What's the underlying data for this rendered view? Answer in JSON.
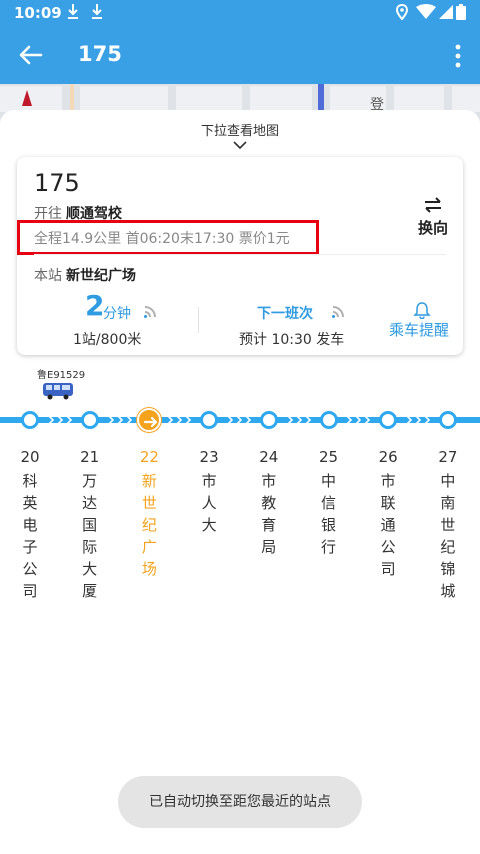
{
  "status_bar": {
    "time": "10:09",
    "icons": [
      "download-icon",
      "download-icon",
      "location-icon",
      "wifi-icon",
      "signal-icon",
      "battery-icon"
    ]
  },
  "app_bar": {
    "title": "175",
    "back_icon": "arrow-left-icon",
    "more_icon": "more-vert-icon"
  },
  "map": {
    "label": "登"
  },
  "sheet": {
    "pull_hint": "下拉查看地图"
  },
  "route_card": {
    "route_no": "175",
    "direction_prefix": "开往",
    "direction_dest": "顺通驾校",
    "info": "全程14.9公里  首06:20末17:30  票价1元",
    "swap_label": "换向",
    "station_prefix": "本站",
    "station_name": "新世纪广场",
    "eta_value": "2",
    "eta_unit": "分钟",
    "eta_detail": "1站/800米",
    "next_title": "下一班次",
    "next_detail": "预计 10:30 发车",
    "remind_label": "乘车提醒"
  },
  "bus": {
    "plate": "鲁E91529"
  },
  "stops": [
    {
      "num": "20",
      "chars": [
        "科",
        "英",
        "电",
        "子",
        "公",
        "司"
      ],
      "current": false
    },
    {
      "num": "21",
      "chars": [
        "万",
        "达",
        "国",
        "际",
        "大",
        "厦"
      ],
      "current": false
    },
    {
      "num": "22",
      "chars": [
        "新",
        "世",
        "纪",
        "广",
        "场"
      ],
      "current": true
    },
    {
      "num": "23",
      "chars": [
        "市",
        "人",
        "大"
      ],
      "current": false
    },
    {
      "num": "24",
      "chars": [
        "市",
        "教",
        "育",
        "局"
      ],
      "current": false
    },
    {
      "num": "25",
      "chars": [
        "中",
        "信",
        "银",
        "行"
      ],
      "current": false
    },
    {
      "num": "26",
      "chars": [
        "市",
        "联",
        "通",
        "公",
        "司"
      ],
      "current": false
    },
    {
      "num": "27",
      "chars": [
        "中",
        "南",
        "世",
        "纪",
        "锦",
        "城"
      ],
      "current": false
    }
  ],
  "colors": {
    "primary": "#3aa0e6",
    "route_line": "#2fa8ee",
    "current_stop": "#f5a21c",
    "highlight_box": "#e60012"
  },
  "toast": "已自动切换至距您最近的站点"
}
